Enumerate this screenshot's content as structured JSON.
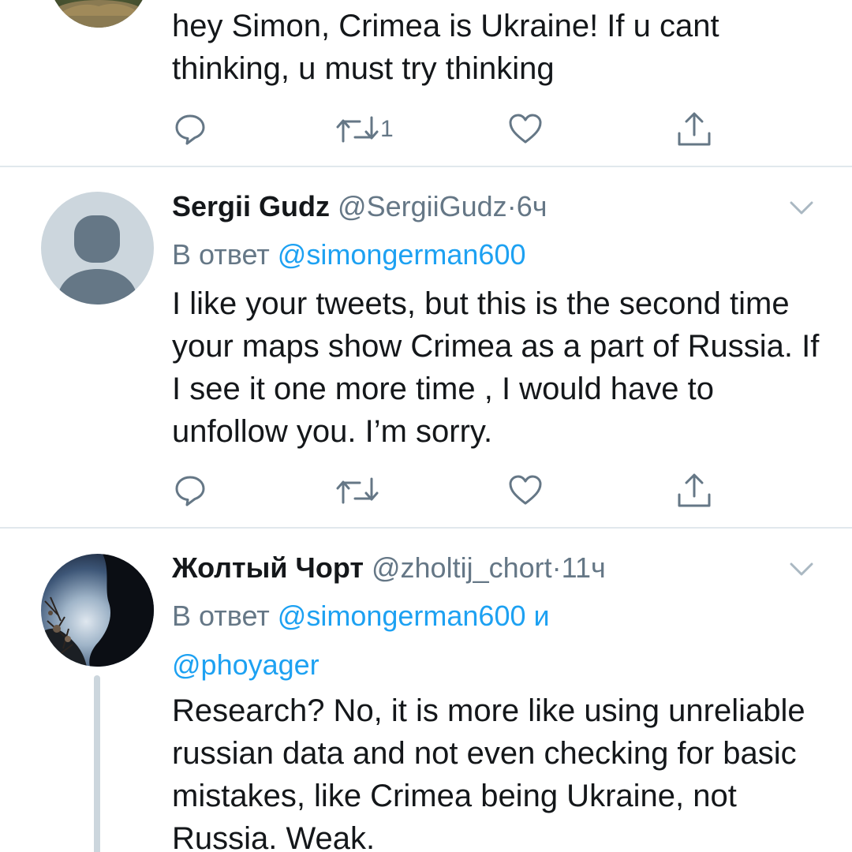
{
  "tweets": [
    {
      "text": "hey Simon, Crimea is Ukraine! If u cant thinking, u must try thinking",
      "actions": {
        "reply_icon": "reply-icon",
        "retweet_icon": "retweet-icon",
        "retweet_count": "1",
        "like_icon": "heart-icon",
        "share_icon": "share-icon"
      }
    },
    {
      "name": "Sergii Gudz",
      "handle": "@SergiiGudz",
      "separator": "·",
      "time": "6ч",
      "reply_prefix": "В ответ",
      "mention1": "@simongerman600",
      "text": "I like your tweets, but this is the second time your maps show Crimea as a part of Russia. If I see it one more time , I would have to unfollow you. I’m sorry.",
      "actions": {
        "reply_icon": "reply-icon",
        "retweet_icon": "retweet-icon",
        "like_icon": "heart-icon",
        "share_icon": "share-icon"
      }
    },
    {
      "name": "Жолтый Чорт",
      "handle": "@zholtij_chort",
      "separator": "·",
      "time": "11ч",
      "reply_prefix": "В ответ",
      "mention1": "@simongerman600",
      "conjunction": "и",
      "mention2": "@phoyager",
      "text": "Research? No, it is more like using unreliable russian data and not even checking for basic mistakes, like Crimea being Ukraine, not Russia. Weak."
    }
  ],
  "colors": {
    "text": "#14171a",
    "secondary": "#657786",
    "link": "#1da1f2",
    "divider": "#e1e8ed",
    "avatar_placeholder": "#ccd6dd"
  }
}
